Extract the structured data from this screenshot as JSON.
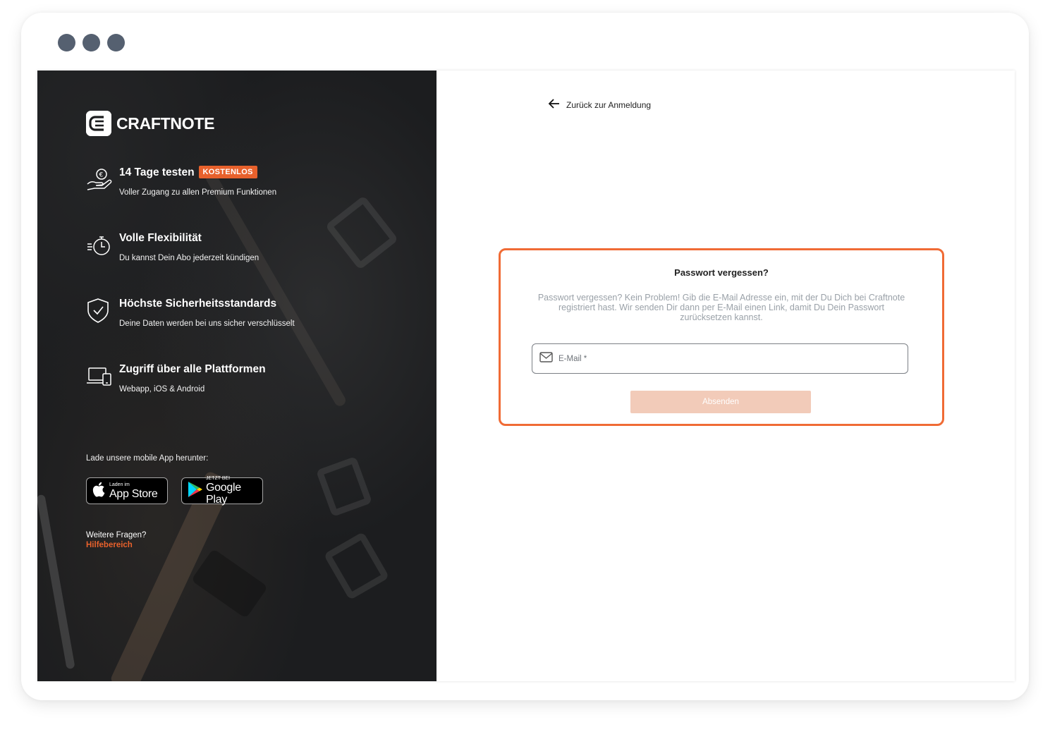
{
  "brand": {
    "name": "CRAFTNOTE",
    "accent_color": "#e8612c"
  },
  "features": [
    {
      "icon": "hand-euro-icon",
      "title": "14 Tage testen",
      "badge": "KOSTENLOS",
      "description": "Voller Zugang zu allen Premium Funktionen"
    },
    {
      "icon": "stopwatch-icon",
      "title": "Volle Flexibilität",
      "description": "Du kannst Dein Abo jederzeit kündigen"
    },
    {
      "icon": "shield-check-icon",
      "title": "Höchste Sicherheitsstandards",
      "description": "Deine Daten werden bei uns sicher verschlüsselt"
    },
    {
      "icon": "devices-icon",
      "title": "Zugriff über alle Plattformen",
      "description": "Webapp, iOS & Android"
    }
  ],
  "download": {
    "label": "Lade unsere mobile App herunter:",
    "app_store": {
      "small": "Laden im",
      "big": "App Store"
    },
    "google_play": {
      "small": "JETZT BEI",
      "big": "Google Play"
    }
  },
  "help": {
    "question": "Weitere Fragen?",
    "link": "Hilfebereich"
  },
  "back_link": "Zurück zur Anmeldung",
  "form": {
    "title": "Passwort vergessen?",
    "description": "Passwort vergessen? Kein Problem! Gib die E-Mail Adresse ein, mit der Du Dich bei Craftnote registriert hast. Wir senden Dir dann per E-Mail einen Link, damit Du Dein Passwort zurücksetzen kannst.",
    "email_placeholder": "E-Mail *",
    "email_value": "",
    "submit_label": "Absenden",
    "border_color": "#f06b35"
  }
}
